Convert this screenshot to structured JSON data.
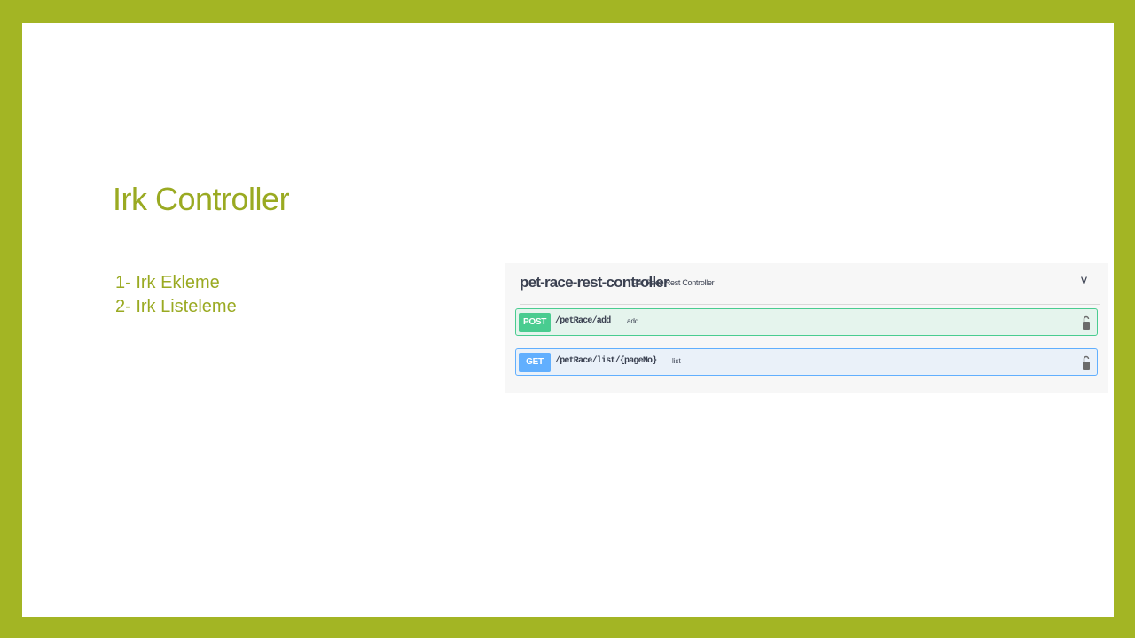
{
  "slide": {
    "title": "Irk Controller",
    "bullets": [
      "1- Irk Ekleme",
      "2- Irk Listeleme"
    ]
  },
  "swagger": {
    "tag": "pet-race-rest-controller",
    "description": "Pet Race Rest Controller",
    "chevron": "v",
    "operations": [
      {
        "method": "POST",
        "path": "/petRace/add",
        "summary": "add",
        "color": "#49cc90"
      },
      {
        "method": "GET",
        "path": "/petRace/list/{pageNo}",
        "summary": "list",
        "color": "#61affe"
      }
    ]
  },
  "colors": {
    "frame": "#a3b524",
    "title": "#9aaa22"
  },
  "icons": {
    "lock": "lock-icon",
    "chevron": "chevron-down-icon"
  }
}
